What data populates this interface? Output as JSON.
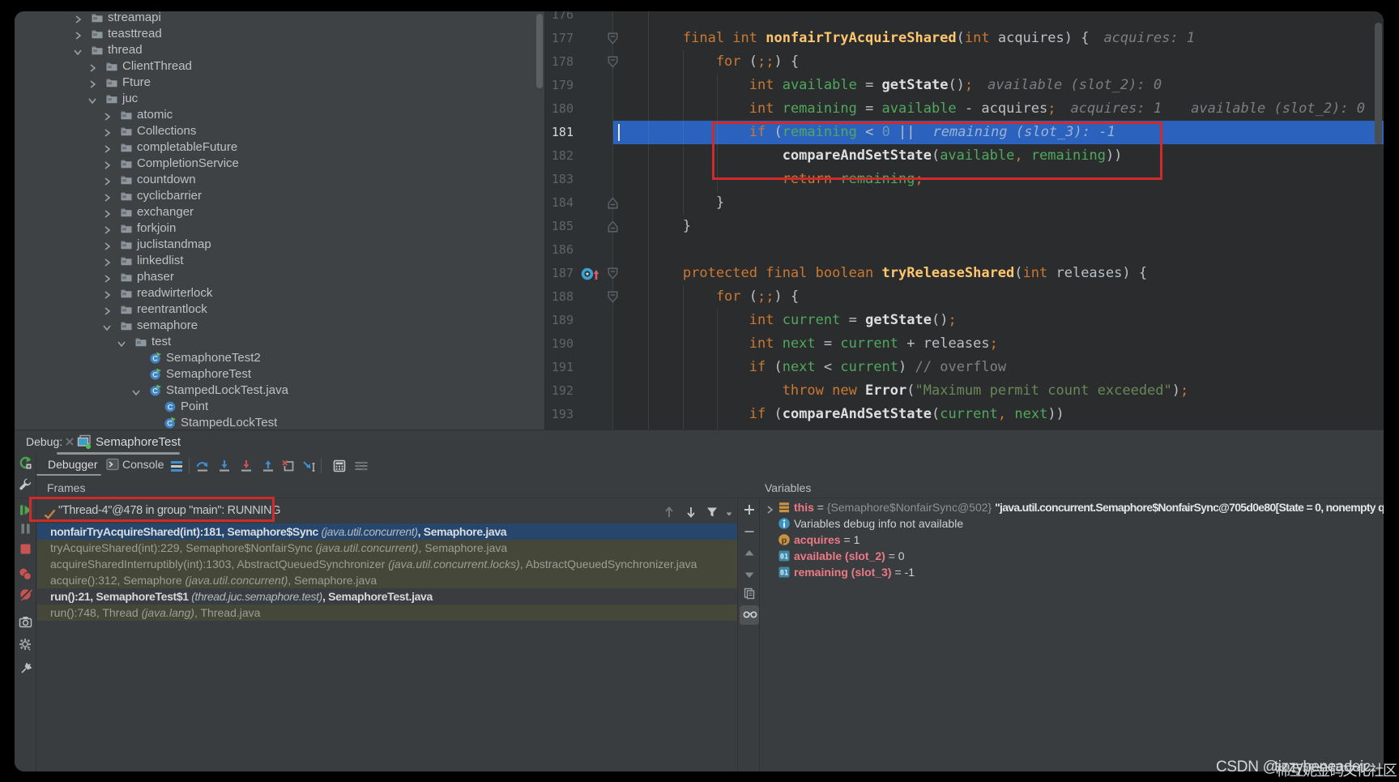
{
  "palette": {
    "background": "#000000",
    "panel_bg": "#3a3d3f",
    "tree_bg": "#3e4245",
    "editor_bg": "#2a2c2d",
    "gutter_bg": "#2e3133",
    "execution_line_blue": "#2b62bd",
    "annotation_red": "#cf2b2b",
    "keyword_orange": "#cc7832",
    "method_decl_yellow": "#ffc66d",
    "variable_green": "#50a85c",
    "number_blue": "#6897bb",
    "string_green": "#6a8759",
    "library_frame_olive": "#454739",
    "selected_frame_navy": "#26466c",
    "variable_name_pink": "#ec7a85",
    "icon_blue": "#3d8fd1",
    "icon_red": "#c75450",
    "icon_green": "#4fa54f"
  },
  "project_tree": {
    "items": [
      {
        "label": "streamapi",
        "level": 0,
        "chevron": "right",
        "icon": "folder"
      },
      {
        "label": "teasttread",
        "level": 0,
        "chevron": "right",
        "icon": "folder"
      },
      {
        "label": "thread",
        "level": 0,
        "chevron": "down",
        "icon": "folder"
      },
      {
        "label": "ClientThread",
        "level": 1,
        "chevron": "right",
        "icon": "folder"
      },
      {
        "label": "Fture",
        "level": 1,
        "chevron": "right",
        "icon": "folder"
      },
      {
        "label": "juc",
        "level": 1,
        "chevron": "down",
        "icon": "folder"
      },
      {
        "label": "atomic",
        "level": 2,
        "chevron": "right",
        "icon": "folder"
      },
      {
        "label": "Collections",
        "level": 2,
        "chevron": "right",
        "icon": "folder"
      },
      {
        "label": "completableFuture",
        "level": 2,
        "chevron": "right",
        "icon": "folder"
      },
      {
        "label": "CompletionService",
        "level": 2,
        "chevron": "right",
        "icon": "folder"
      },
      {
        "label": "countdown",
        "level": 2,
        "chevron": "right",
        "icon": "folder"
      },
      {
        "label": "cyclicbarrier",
        "level": 2,
        "chevron": "right",
        "icon": "folder"
      },
      {
        "label": "exchanger",
        "level": 2,
        "chevron": "right",
        "icon": "folder"
      },
      {
        "label": "forkjoin",
        "level": 2,
        "chevron": "right",
        "icon": "folder"
      },
      {
        "label": "juclistandmap",
        "level": 2,
        "chevron": "right",
        "icon": "folder"
      },
      {
        "label": "linkedlist",
        "level": 2,
        "chevron": "right",
        "icon": "folder"
      },
      {
        "label": "phaser",
        "level": 2,
        "chevron": "right",
        "icon": "folder"
      },
      {
        "label": "readwirterlock",
        "level": 2,
        "chevron": "right",
        "icon": "folder"
      },
      {
        "label": "reentrantlock",
        "level": 2,
        "chevron": "right",
        "icon": "folder"
      },
      {
        "label": "semaphore",
        "level": 2,
        "chevron": "down",
        "icon": "folder"
      },
      {
        "label": "test",
        "level": 3,
        "chevron": "down",
        "icon": "folder"
      },
      {
        "label": "SemaphoneTest2",
        "level": 4,
        "chevron": null,
        "icon": "class-run"
      },
      {
        "label": "SemaphoreTest",
        "level": 4,
        "chevron": null,
        "icon": "class-run"
      },
      {
        "label": "StampedLockTest.java",
        "level": 4,
        "chevron": "down",
        "icon": "class-run"
      },
      {
        "label": "Point",
        "level": 5,
        "chevron": null,
        "icon": "class"
      },
      {
        "label": "StampedLockTest",
        "level": 5,
        "chevron": null,
        "icon": "class-run"
      }
    ]
  },
  "editor": {
    "current_line": 181,
    "lines": [
      {
        "n": 176,
        "tokens": []
      },
      {
        "n": 177,
        "fold": "down",
        "tokens": [
          [
            "kw",
            "        final int "
          ],
          [
            "fn",
            "nonfairTryAcquireShared"
          ],
          [
            "pl",
            "("
          ],
          [
            "kw",
            "int"
          ],
          [
            "pl",
            " acquires) {"
          ]
        ],
        "hints": [
          {
            "text": "acquires: 1",
            "gap": 18
          }
        ]
      },
      {
        "n": 178,
        "fold": "down",
        "tokens": [
          [
            "kw",
            "            for "
          ],
          [
            "pl",
            "("
          ],
          [
            "sc",
            ";;"
          ],
          [
            "pl",
            ") {"
          ]
        ]
      },
      {
        "n": 179,
        "tokens": [
          [
            "kw",
            "                int "
          ],
          [
            "v",
            "available"
          ],
          [
            "pl",
            " = "
          ],
          [
            "mth",
            "getState"
          ],
          [
            "pl",
            "()"
          ],
          [
            "sc",
            ";"
          ]
        ],
        "hints": [
          {
            "text": "available (slot_2): 0",
            "gap": 18
          }
        ]
      },
      {
        "n": 180,
        "tokens": [
          [
            "kw",
            "                int "
          ],
          [
            "v",
            "remaining"
          ],
          [
            "pl",
            " = "
          ],
          [
            "v",
            "available"
          ],
          [
            "pl",
            " - acquires"
          ],
          [
            "sc",
            ";"
          ]
        ],
        "hints": [
          {
            "text": "acquires: 1",
            "gap": 18
          },
          {
            "text": "available (slot_2): 0",
            "gap": 36
          }
        ]
      },
      {
        "n": 181,
        "tokens": [
          [
            "kw",
            "                if "
          ],
          [
            "pl",
            "("
          ],
          [
            "v",
            "remaining"
          ],
          [
            "pl",
            " < "
          ],
          [
            "num",
            "0"
          ],
          [
            "pl",
            " ||"
          ]
        ],
        "hints": [
          {
            "text": "remaining (slot_3): -1",
            "gap": 22
          }
        ]
      },
      {
        "n": 182,
        "tokens": [
          [
            "mth",
            "                    compareAndSetState"
          ],
          [
            "pl",
            "("
          ],
          [
            "v",
            "available"
          ],
          [
            "sc",
            ","
          ],
          [
            "pl",
            " "
          ],
          [
            "v",
            "remaining"
          ],
          [
            "pl",
            "))"
          ]
        ]
      },
      {
        "n": 183,
        "tokens": [
          [
            "kw",
            "                    return "
          ],
          [
            "v",
            "remaining"
          ],
          [
            "sc",
            ";"
          ]
        ]
      },
      {
        "n": 184,
        "fold": "up",
        "tokens": [
          [
            "pl",
            "            }"
          ]
        ]
      },
      {
        "n": 185,
        "fold": "up",
        "tokens": [
          [
            "pl",
            "        }"
          ]
        ]
      },
      {
        "n": 186,
        "tokens": []
      },
      {
        "n": 187,
        "fold": "down",
        "gutter_icon": true,
        "tokens": [
          [
            "kw",
            "        protected final boolean "
          ],
          [
            "fn",
            "tryReleaseShared"
          ],
          [
            "pl",
            "("
          ],
          [
            "kw",
            "int"
          ],
          [
            "pl",
            " releases) {"
          ]
        ]
      },
      {
        "n": 188,
        "fold": "down",
        "tokens": [
          [
            "kw",
            "            for "
          ],
          [
            "pl",
            "("
          ],
          [
            "sc",
            ";;"
          ],
          [
            "pl",
            ") {"
          ]
        ]
      },
      {
        "n": 189,
        "tokens": [
          [
            "kw",
            "                int "
          ],
          [
            "v",
            "current"
          ],
          [
            "pl",
            " = "
          ],
          [
            "mth",
            "getState"
          ],
          [
            "pl",
            "()"
          ],
          [
            "sc",
            ";"
          ]
        ]
      },
      {
        "n": 190,
        "tokens": [
          [
            "kw",
            "                int "
          ],
          [
            "v",
            "next"
          ],
          [
            "pl",
            " = "
          ],
          [
            "v",
            "current"
          ],
          [
            "pl",
            " + releases"
          ],
          [
            "sc",
            ";"
          ]
        ]
      },
      {
        "n": 191,
        "tokens": [
          [
            "kw",
            "                if "
          ],
          [
            "pl",
            "("
          ],
          [
            "v",
            "next"
          ],
          [
            "pl",
            " < "
          ],
          [
            "v",
            "current"
          ],
          [
            "pl",
            ") "
          ],
          [
            "cmt",
            "// overflow"
          ]
        ]
      },
      {
        "n": 192,
        "tokens": [
          [
            "kw",
            "                    throw new "
          ],
          [
            "mth",
            "Error"
          ],
          [
            "pl",
            "("
          ],
          [
            "str",
            "\"Maximum permit count exceeded\""
          ],
          [
            "pl",
            ")"
          ],
          [
            "sc",
            ";"
          ]
        ]
      },
      {
        "n": 193,
        "tokens": [
          [
            "kw",
            "                if "
          ],
          [
            "pl",
            "("
          ],
          [
            "mth",
            "compareAndSetState"
          ],
          [
            "pl",
            "("
          ],
          [
            "v",
            "current"
          ],
          [
            "sc",
            ","
          ],
          [
            "pl",
            " "
          ],
          [
            "v",
            "next"
          ],
          [
            "pl",
            "))"
          ]
        ]
      }
    ]
  },
  "debug": {
    "panel_label": "Debug:",
    "session_tab": {
      "label": "SemaphoreTest"
    },
    "view_tabs": {
      "debugger": "Debugger",
      "console": "Console"
    },
    "toolbar_icons": [
      "show-execution-point",
      "step-over",
      "step-into",
      "force-step-into",
      "step-out",
      "drop-frame",
      "run-to-cursor",
      "evaluate-expression",
      "layout-settings"
    ],
    "left_toolbar_icons": [
      "rerun",
      "debugger-settings-wrench",
      "resume",
      "pause",
      "stop",
      "view-breakpoints",
      "mute-breakpoints",
      "thread-dump-camera",
      "settings-gear",
      "pin"
    ],
    "frames": {
      "header": "Frames",
      "thread_status": "\"Thread-4\"@478 in group \"main\": RUNNING",
      "rows": [
        {
          "state": "selected",
          "segments": [
            [
              "t",
              "nonfairTryAcquireShared(int):181, Semaphore$Sync "
            ],
            [
              "i",
              "(java.util.concurrent)"
            ],
            [
              "t",
              ", Semaphore.java"
            ]
          ]
        },
        {
          "state": "lib",
          "segments": [
            [
              "t",
              "tryAcquireShared(int):229, Semaphore$NonfairSync "
            ],
            [
              "i",
              "(java.util.concurrent)"
            ],
            [
              "t",
              ", Semaphore.java"
            ]
          ]
        },
        {
          "state": "lib",
          "segments": [
            [
              "t",
              "acquireSharedInterruptibly(int):1303, AbstractQueuedSynchronizer "
            ],
            [
              "i",
              "(java.util.concurrent.locks)"
            ],
            [
              "t",
              ", AbstractQueuedSynchronizer.java"
            ]
          ]
        },
        {
          "state": "lib",
          "segments": [
            [
              "t",
              "acquire():312, Semaphore "
            ],
            [
              "i",
              "(java.util.concurrent)"
            ],
            [
              "t",
              ", Semaphore.java"
            ]
          ]
        },
        {
          "state": "normal",
          "segments": [
            [
              "t",
              "run():21, SemaphoreTest$1 "
            ],
            [
              "i",
              "(thread.juc.semaphore.test)"
            ],
            [
              "t",
              ", SemaphoreTest.java"
            ]
          ]
        },
        {
          "state": "lib",
          "segments": [
            [
              "t",
              "run():748, Thread "
            ],
            [
              "i",
              "(java.lang)"
            ],
            [
              "t",
              ", Thread.java"
            ]
          ]
        }
      ]
    },
    "variables": {
      "header": "Variables",
      "rows": [
        {
          "icon": "value-bars",
          "expander": true,
          "segments": [
            [
              "name",
              "this"
            ],
            [
              "eq",
              " = "
            ],
            [
              "ref",
              "{Semaphore$NonfairSync@502} "
            ],
            [
              "str",
              "\"java.util.concurrent.Semaphore$NonfairSync@705d0e80[State = 0, nonempty q"
            ]
          ]
        },
        {
          "icon": "info",
          "segments": [
            [
              "plain",
              "Variables debug info not available"
            ]
          ]
        },
        {
          "icon": "param",
          "segments": [
            [
              "name",
              "acquires"
            ],
            [
              "eq",
              " = "
            ],
            [
              "val",
              "1"
            ]
          ]
        },
        {
          "icon": "slot",
          "segments": [
            [
              "name",
              "available (slot_2)"
            ],
            [
              "eq",
              " = "
            ],
            [
              "val",
              "0"
            ]
          ]
        },
        {
          "icon": "slot",
          "segments": [
            [
              "name",
              "remaining (slot_3)"
            ],
            [
              "eq",
              " = "
            ],
            [
              "val",
              "-1"
            ]
          ]
        }
      ]
    }
  },
  "watermark": {
    "prefix": "CSDN @",
    "latin": "tizzybeneadeic",
    "cjk": "棉互妮金码文化社区"
  }
}
